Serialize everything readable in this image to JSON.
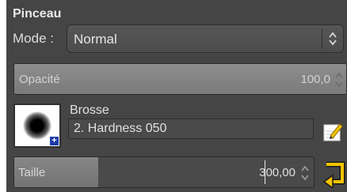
{
  "panel": {
    "title": "Pinceau",
    "bg_color": "#454545"
  },
  "mode": {
    "label": "Mode :",
    "value": "Normal"
  },
  "opacity": {
    "label": "Opacité",
    "value": "100,0",
    "fill_fraction": 1.0
  },
  "brush": {
    "label": "Brosse",
    "name": "2. Hardness 050",
    "preview_badge": "+",
    "preview_icon": "brush-soft-round-icon"
  },
  "size": {
    "label": "Taille",
    "value": "300,00",
    "fill_fraction": 0.28
  },
  "icons": {
    "mode_spinner": "updown-chevron-icon",
    "opacity_spinner": "updown-chevron-icon",
    "size_spinner": "updown-chevron-icon",
    "edit": "pencil-edit-icon",
    "reset": "reset-arrow-icon"
  },
  "colors": {
    "accent_yellow": "#f5c400",
    "badge_blue": "#1a3aa8"
  }
}
